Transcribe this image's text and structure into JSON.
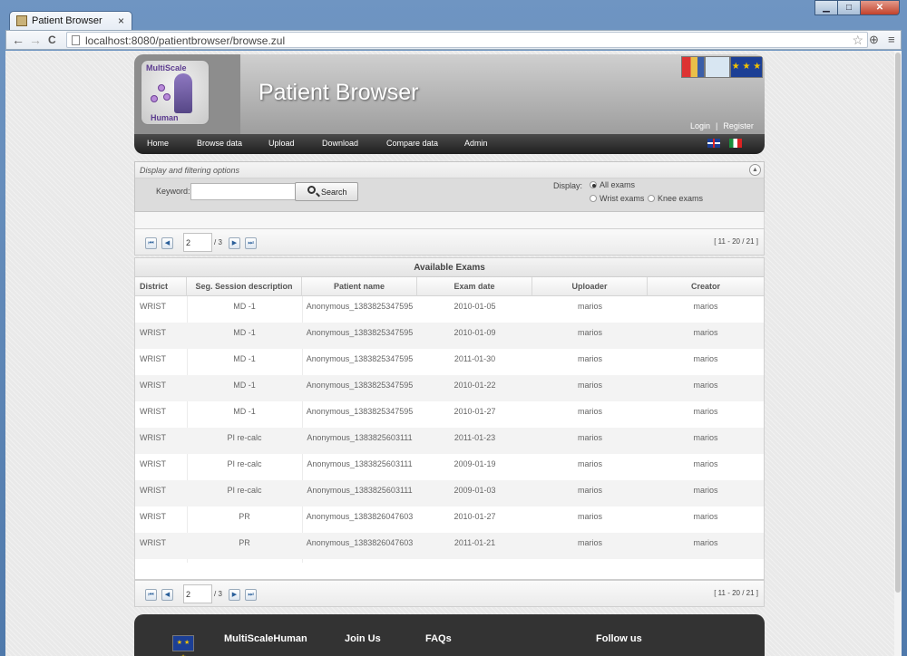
{
  "browser": {
    "tab_title": "Patient Browser",
    "tab_close": "×",
    "url": "localhost:8080/patientbrowser/browse.zul",
    "window_buttons": {
      "minimize": "▁",
      "maximize": "□",
      "close": "✕"
    },
    "back": "←",
    "forward": "→",
    "reload": "C",
    "star": "☆",
    "ext_icon": "⊕",
    "menu": "≡"
  },
  "header": {
    "logo_top": "MultiScale",
    "logo_bottom": "Human",
    "site_title": "Patient Browser",
    "login": "Login",
    "separator": "|",
    "register": "Register",
    "eu_stars": "★ ★ ★"
  },
  "menu": {
    "items": [
      "Home",
      "Browse data",
      "Upload",
      "Download",
      "Compare data",
      "Admin"
    ]
  },
  "filter": {
    "title": "Display and filtering options",
    "collapse_icon": "▲",
    "keyword_label": "Keyword:",
    "keyword_value": "",
    "search_label": "Search",
    "display_label": "Display:",
    "options": [
      {
        "label": "All exams",
        "selected": true
      },
      {
        "label": "Wrist exams",
        "selected": false
      },
      {
        "label": "Knee exams",
        "selected": false
      }
    ]
  },
  "pager": {
    "current_page": "2",
    "total": "/ 3",
    "range": "[ 11 - 20 / 21 ]",
    "first": "⏮",
    "prev": "◀",
    "next": "▶",
    "last": "⏭"
  },
  "grid": {
    "caption": "Available Exams",
    "columns": [
      "District",
      "Seg. Session description",
      "Patient name",
      "Exam date",
      "Uploader",
      "Creator"
    ],
    "rows": [
      [
        "WRIST",
        "MD -1",
        "Anonymous_1383825347595",
        "2010-01-05",
        "marios",
        "marios"
      ],
      [
        "WRIST",
        "MD -1",
        "Anonymous_1383825347595",
        "2010-01-09",
        "marios",
        "marios"
      ],
      [
        "WRIST",
        "MD -1",
        "Anonymous_1383825347595",
        "2011-01-30",
        "marios",
        "marios"
      ],
      [
        "WRIST",
        "MD -1",
        "Anonymous_1383825347595",
        "2010-01-22",
        "marios",
        "marios"
      ],
      [
        "WRIST",
        "MD -1",
        "Anonymous_1383825347595",
        "2010-01-27",
        "marios",
        "marios"
      ],
      [
        "WRIST",
        "PI re-calc",
        "Anonymous_1383825603111",
        "2011-01-23",
        "marios",
        "marios"
      ],
      [
        "WRIST",
        "PI re-calc",
        "Anonymous_1383825603111",
        "2009-01-19",
        "marios",
        "marios"
      ],
      [
        "WRIST",
        "PI re-calc",
        "Anonymous_1383825603111",
        "2009-01-03",
        "marios",
        "marios"
      ],
      [
        "WRIST",
        "PR",
        "Anonymous_1383826047603",
        "2010-01-27",
        "marios",
        "marios"
      ],
      [
        "WRIST",
        "PR",
        "Anonymous_1383826047603",
        "2011-01-21",
        "marios",
        "marios"
      ]
    ]
  },
  "footer": {
    "links": [
      "MultiScaleHuman",
      "Join Us",
      "FAQs",
      "Follow us"
    ]
  }
}
